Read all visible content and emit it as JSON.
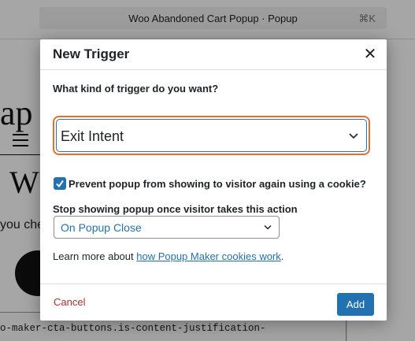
{
  "background": {
    "command_bar": {
      "title": "Woo Abandoned Cart Popup · Popup",
      "shortcut": "⌘K"
    },
    "heading_fragment": "ap",
    "title_fragment": "W",
    "text_fragment": "you che",
    "code_fragment": "o-maker-cta-buttons.is-content-justification-"
  },
  "modal": {
    "title": "New Trigger",
    "close_icon": "close-icon",
    "question": "What kind of trigger do you want?",
    "trigger_select": {
      "value": "Exit Intent",
      "focus_color": "#e26f2a"
    },
    "cookie_checkbox": {
      "checked": true,
      "label": "Prevent popup from showing to visitor again using a cookie?"
    },
    "stop_label": "Stop showing popup once visitor takes this action",
    "action_select": {
      "value": "On Popup Close"
    },
    "learn_more": {
      "prefix": "Learn more about ",
      "link": "how Popup Maker cookies work",
      "suffix": "."
    },
    "footer": {
      "cancel": "Cancel",
      "add": "Add"
    }
  },
  "colors": {
    "primary": "#2271b1",
    "danger": "#b32d2e",
    "focus": "#e26f2a"
  }
}
